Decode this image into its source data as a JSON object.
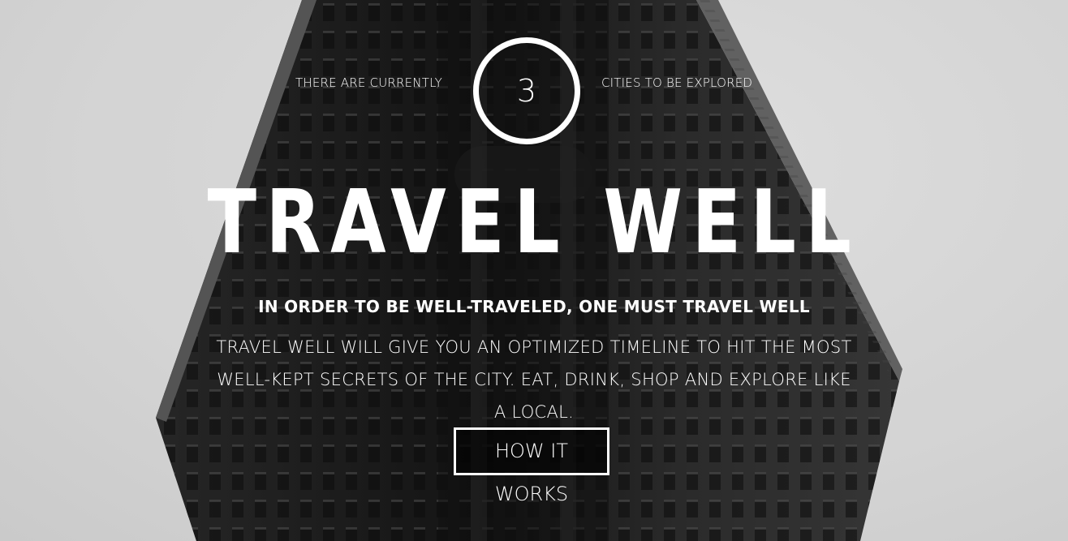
{
  "hero": {
    "counter": {
      "prefix": "THERE ARE CURRENTLY",
      "value": "3",
      "suffix": "CITIES TO BE EXPLORED"
    },
    "title": "TRAVEL WELL",
    "subtitle": "IN ORDER TO BE WELL-TRAVELED, ONE MUST TRAVEL WELL",
    "description": "TRAVEL WELL WILL GIVE YOU AN OPTIMIZED TIMELINE TO HIT THE MOST WELL-KEPT SECRETS OF THE CITY. EAT, DRINK, SHOP AND EXPLORE LIKE A LOCAL.",
    "cta_label": "HOW IT WORKS"
  },
  "colors": {
    "text": "#ffffff",
    "background": "#e9e9e9",
    "building": "#1f1f1f"
  }
}
